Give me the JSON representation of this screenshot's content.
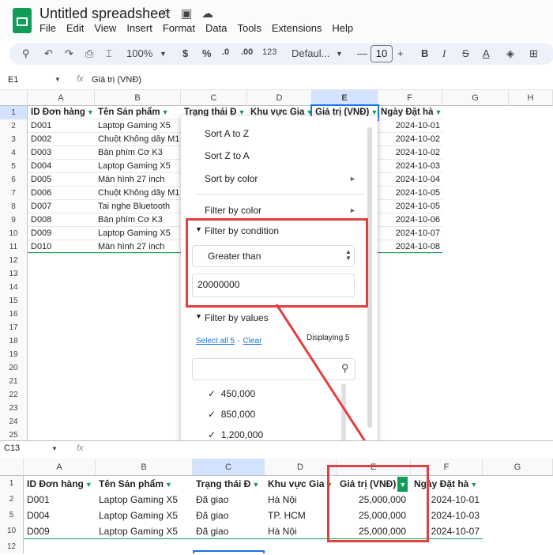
{
  "app": {
    "title": "Untitled spreadsheet",
    "menu": [
      "File",
      "Edit",
      "View",
      "Insert",
      "Format",
      "Data",
      "Tools",
      "Extensions",
      "Help"
    ]
  },
  "toolbar": {
    "zoom": "100%",
    "currency": "$",
    "percent": "%",
    "dec_dec": ".0",
    "inc_dec": ".00",
    "num_fmt": "123",
    "font": "Defaul...",
    "font_size": "10",
    "minus": "—",
    "plus": "+",
    "bold": "B",
    "italic": "I",
    "strike": "S",
    "text_color": "A"
  },
  "formula": {
    "ref": "E1",
    "fx": "fx",
    "value": "Giá trị (VNĐ)"
  },
  "columns": [
    "A",
    "B",
    "C",
    "D",
    "E",
    "F",
    "G",
    "H"
  ],
  "headers": [
    "ID Đơn hàng",
    "Tên Sản phẩm",
    "Trạng thái Đ",
    "Khu vực Gia",
    "Giá trị (VNĐ)",
    "Ngày Đặt hà"
  ],
  "rows": [
    {
      "n": "1"
    },
    {
      "n": "2",
      "a": "D001",
      "b": "Laptop Gaming X5",
      "f": "2024-10-01"
    },
    {
      "n": "3",
      "a": "D002",
      "b": "Chuột Không dây M1",
      "f": "2024-10-02"
    },
    {
      "n": "4",
      "a": "D003",
      "b": "Bàn phím Cơ K3",
      "f": "2024-10-02"
    },
    {
      "n": "5",
      "a": "D004",
      "b": "Laptop Gaming X5",
      "f": "2024-10-03"
    },
    {
      "n": "6",
      "a": "D005",
      "b": "Màn hình 27 inch",
      "f": "2024-10-04"
    },
    {
      "n": "7",
      "a": "D006",
      "b": "Chuột Không dây M1",
      "f": "2024-10-05"
    },
    {
      "n": "8",
      "a": "D007",
      "b": "Tai nghe Bluetooth",
      "f": "2024-10-05"
    },
    {
      "n": "9",
      "a": "D008",
      "b": "Bàn phím Cơ K3",
      "f": "2024-10-06"
    },
    {
      "n": "10",
      "a": "D009",
      "b": "Laptop Gaming X5",
      "f": "2024-10-07"
    },
    {
      "n": "11",
      "a": "D010",
      "b": "Màn hình 27 inch",
      "f": "2024-10-08"
    },
    {
      "n": "12"
    },
    {
      "n": "13"
    },
    {
      "n": "14"
    },
    {
      "n": "15"
    },
    {
      "n": "16"
    },
    {
      "n": "17"
    },
    {
      "n": "18"
    },
    {
      "n": "19"
    },
    {
      "n": "20"
    },
    {
      "n": "21"
    },
    {
      "n": "22"
    },
    {
      "n": "23"
    },
    {
      "n": "24"
    },
    {
      "n": "25"
    }
  ],
  "dropdown": {
    "sort_az": "Sort A to Z",
    "sort_za": "Sort Z to A",
    "sort_color": "Sort by color",
    "filter_color": "Filter by color",
    "by_condition": "Filter by condition",
    "condition": "Greater than",
    "cond_value": "20000000",
    "by_values": "Filter by values",
    "select_all": "Select all 5",
    "clear": "Clear",
    "sep": "-",
    "displaying": "Displaying 5",
    "values": [
      "450,000",
      "850,000",
      "1,200,000"
    ]
  },
  "bottom": {
    "ref": "C13",
    "fx": "fx",
    "columns": [
      "A",
      "B",
      "C",
      "D",
      "E",
      "F",
      "G"
    ],
    "headers": [
      "ID Đơn hàng",
      "Tên Sản phẩm",
      "Trạng thái Đ",
      "Khu vực Gia",
      "Giá trị (VNĐ)",
      "Ngày Đặt hà"
    ],
    "rows": [
      {
        "n": "1"
      },
      {
        "n": "2",
        "a": "D001",
        "b": "Laptop Gaming X5",
        "c": "Đã giao",
        "d": "Hà Nội",
        "e": "25,000,000",
        "f": "2024-10-01"
      },
      {
        "n": "5",
        "a": "D004",
        "b": "Laptop Gaming X5",
        "c": "Đã giao",
        "d": "TP. HCM",
        "e": "25,000,000",
        "f": "2024-10-03"
      },
      {
        "n": "10",
        "a": "D009",
        "b": "Laptop Gaming X5",
        "c": "Đã giao",
        "d": "Hà Nội",
        "e": "25,000,000",
        "f": "2024-10-07"
      },
      {
        "n": "12"
      }
    ]
  },
  "colors": {
    "accent": "#1a73e8",
    "green": "#0f9d58",
    "red": "#e04040",
    "header_sel": "#d3e3fd"
  }
}
